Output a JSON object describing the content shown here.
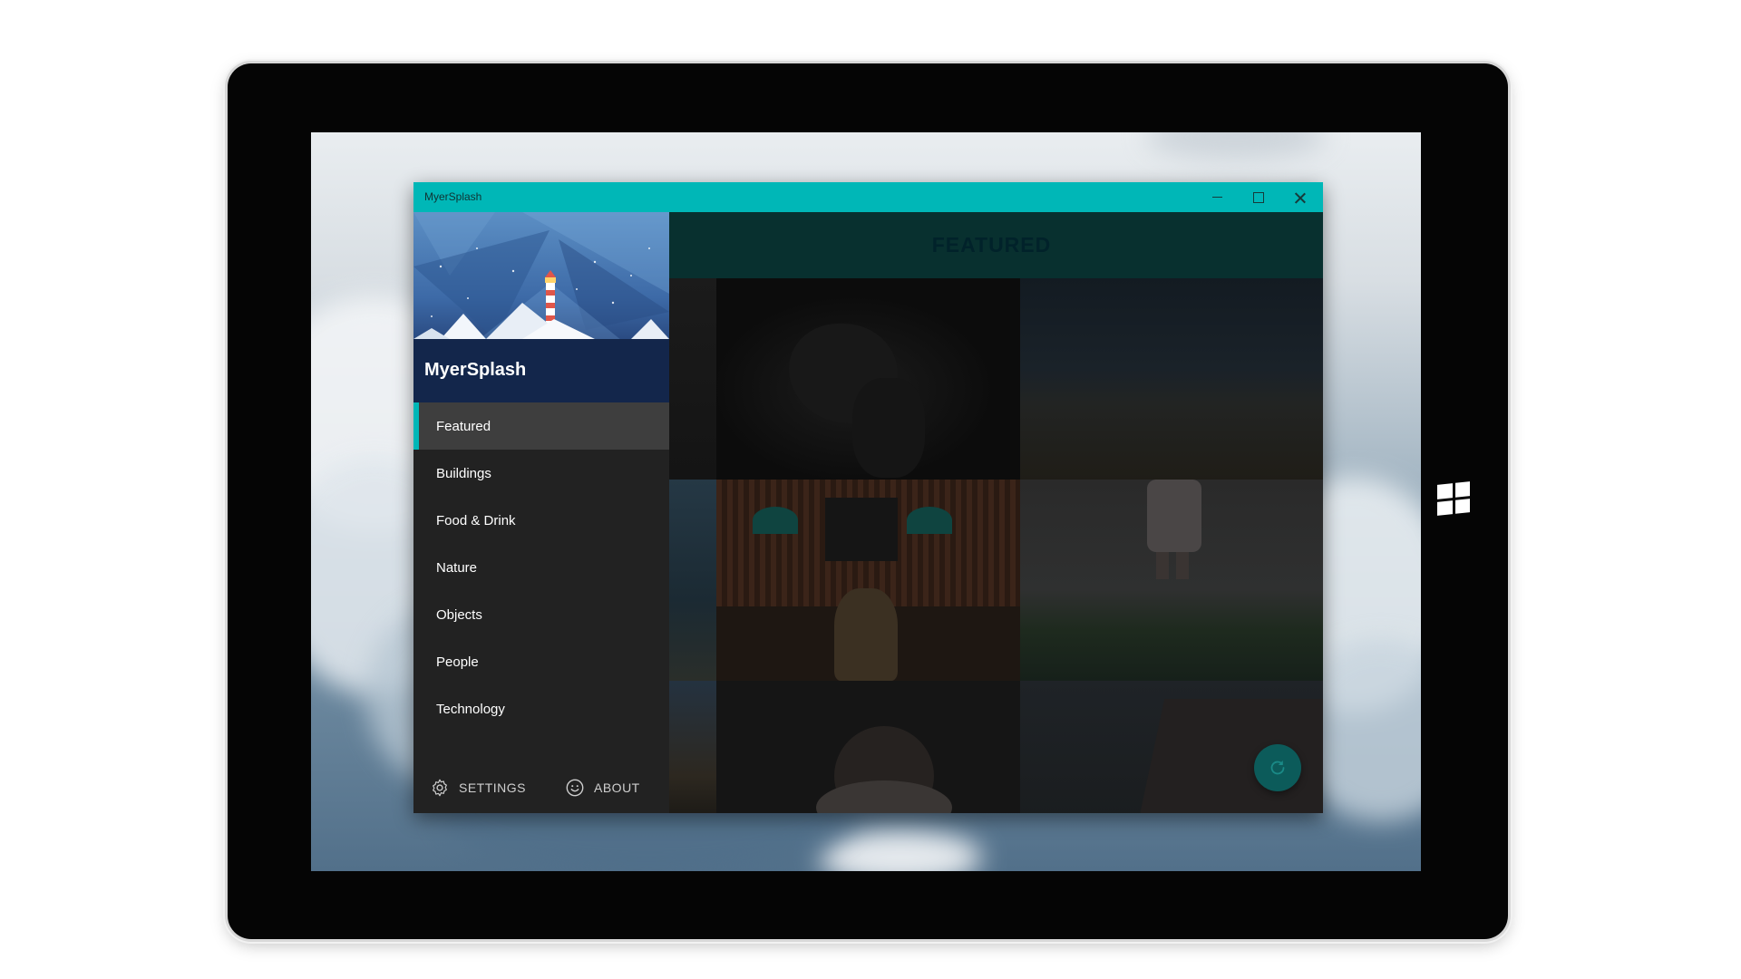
{
  "window": {
    "title": "MyerSplash",
    "minimize_icon": "minimize-icon",
    "maximize_icon": "maximize-icon",
    "close_icon": "close-icon"
  },
  "sidebar": {
    "app_name": "MyerSplash",
    "items": [
      {
        "label": "Featured",
        "active": true
      },
      {
        "label": "Buildings"
      },
      {
        "label": "Food & Drink"
      },
      {
        "label": "Nature"
      },
      {
        "label": "Objects"
      },
      {
        "label": "People"
      },
      {
        "label": "Technology"
      }
    ],
    "settings_label": "SETTINGS",
    "about_label": "ABOUT",
    "settings_icon": "gear-icon",
    "about_icon": "smiley-icon"
  },
  "main": {
    "title": "FEATURED",
    "refresh_icon": "refresh-icon",
    "photos": [
      {
        "subject": "dark dog portrait"
      },
      {
        "subject": "dusky field landscape"
      },
      {
        "subject": "cafe interior with person in hat"
      },
      {
        "subject": "person standing in grass"
      },
      {
        "subject": "pug"
      },
      {
        "subject": "cliffs with waterfall"
      }
    ]
  },
  "colors": {
    "accent": "#00b7b7",
    "sidebar_bg": "#222222",
    "header_bg": "#08302f"
  }
}
